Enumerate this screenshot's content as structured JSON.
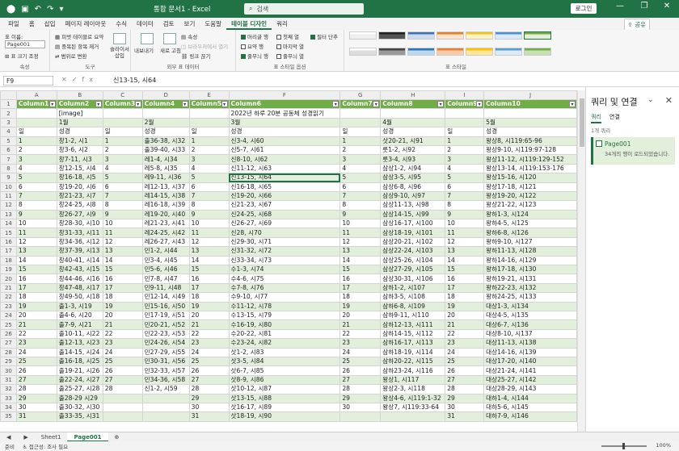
{
  "titlebar": {
    "doc_title": "통합 문서1 - Excel",
    "search_placeholder": "검색",
    "login": "로그인",
    "autosave_icon": "save-icon"
  },
  "tabs": [
    "파일",
    "홈",
    "삽입",
    "페이지 레이아웃",
    "수식",
    "데이터",
    "검토",
    "보기",
    "도움말",
    "테이블 디자인",
    "쿼리"
  ],
  "active_tab": "테이블 디자인",
  "share_label": "공유",
  "ribbon": {
    "props_label": "표 이름:",
    "table_name": "Page001",
    "resize": "표 크기 조정",
    "props_group": "속성",
    "pivot": "피벗 테이블로 요약",
    "remove_dup": "중복된 항목 제거",
    "to_range": "범위로 변환",
    "slicer": "슬라이서 삽입",
    "tools_group": "도구",
    "export": "내보내기",
    "refresh": "새로 고침",
    "properties": "속성",
    "open_browser": "브라우저에서 열기",
    "unlink": "링크 끊기",
    "ext_group": "외부 표 데이터",
    "opt_header": "머리글 행",
    "opt_total": "요약 행",
    "opt_banded": "줄무늬 행",
    "opt_first": "첫째 열",
    "opt_last": "마지막 열",
    "opt_bandcol": "줄무늬 열",
    "opt_filter": "필터 단추",
    "opts_group": "표 스타일 옵션",
    "styles_group": "표 스타일"
  },
  "formula": {
    "name_box": "F9",
    "value": "신13-15, 시64"
  },
  "columns": [
    "A",
    "B",
    "C",
    "D",
    "E",
    "F",
    "G",
    "H",
    "I",
    "J"
  ],
  "table_headers": [
    "Column1",
    "Column2",
    "Column3",
    "Column4",
    "Column5",
    "Column6",
    "Column7",
    "Column8",
    "Column9",
    "Column10"
  ],
  "rows": [
    {
      "n": "2",
      "c": [
        "",
        "[image]",
        "",
        "",
        "",
        "2022년 하루 20분 공동체 성경읽기",
        "",
        "",
        "",
        ""
      ]
    },
    {
      "n": "3",
      "c": [
        "",
        "1월",
        "",
        "2월",
        "",
        "3월",
        "",
        "4월",
        "",
        "5월"
      ]
    },
    {
      "n": "4",
      "c": [
        "일",
        "성경",
        "일",
        "성경",
        "일",
        "성경",
        "일",
        "성경",
        "일",
        "성경"
      ]
    },
    {
      "n": "5",
      "c": [
        "1",
        "창1-2, 시1",
        "1",
        "출36-38, 시32",
        "1",
        "신3-4, 시60",
        "1",
        "삿20-21, 시91",
        "1",
        "왕상8, 시119:65-96"
      ]
    },
    {
      "n": "6",
      "c": [
        "2",
        "창3-6, 시2",
        "2",
        "출39-40, 시33",
        "2",
        "신5-7, 시61",
        "2",
        "룻1-2, 시92",
        "2",
        "왕상9-10, 시119:97-128"
      ]
    },
    {
      "n": "7",
      "c": [
        "3",
        "창7-11, 시3",
        "3",
        "레1-4, 시34",
        "3",
        "신8-10, 시62",
        "3",
        "룻3-4, 시93",
        "3",
        "왕상11-12, 시119:129-152"
      ]
    },
    {
      "n": "8",
      "c": [
        "4",
        "창12-15, 시4",
        "4",
        "레5-8, 시35",
        "4",
        "신11-12, 시63",
        "4",
        "삼상1-2, 시94",
        "4",
        "왕상13-14, 시119:153-176"
      ]
    },
    {
      "n": "9",
      "c": [
        "5",
        "창16-18, 시5",
        "5",
        "레9-11, 시36",
        "5",
        "신13-15, 시64",
        "5",
        "삼상3-5, 시95",
        "5",
        "왕상15-16, 시120"
      ]
    },
    {
      "n": "10",
      "c": [
        "6",
        "창19-20, 시6",
        "6",
        "레12-13, 시37",
        "6",
        "신16-18, 시65",
        "6",
        "삼상6-8, 시96",
        "6",
        "왕상17-18, 시121"
      ]
    },
    {
      "n": "11",
      "c": [
        "7",
        "창21-23, 시7",
        "7",
        "레14-15, 시38",
        "7",
        "신19-20, 시66",
        "7",
        "삼상9-10, 시97",
        "7",
        "왕상19-20, 시122"
      ]
    },
    {
      "n": "12",
      "c": [
        "8",
        "창24-25, 시8",
        "8",
        "레16-18, 시39",
        "8",
        "신21-23, 시67",
        "8",
        "삼상11-13, 시98",
        "8",
        "왕상21-22, 시123"
      ]
    },
    {
      "n": "13",
      "c": [
        "9",
        "창26-27, 시9",
        "9",
        "레19-20, 시40",
        "9",
        "신24-25, 시68",
        "9",
        "삼상14-15, 시99",
        "9",
        "왕하1-3, 시124"
      ]
    },
    {
      "n": "14",
      "c": [
        "10",
        "창28-30, 시10",
        "10",
        "레21-23, 시41",
        "10",
        "신26-27, 시69",
        "10",
        "삼상16-17, 시100",
        "10",
        "왕하4-5, 시125"
      ]
    },
    {
      "n": "15",
      "c": [
        "11",
        "창31-33, 시11",
        "11",
        "레24-25, 시42",
        "11",
        "신28, 시70",
        "11",
        "삼상18-19, 시101",
        "11",
        "왕하6-8, 시126"
      ]
    },
    {
      "n": "16",
      "c": [
        "12",
        "창34-36, 시12",
        "12",
        "레26-27, 시43",
        "12",
        "신29-30, 시71",
        "12",
        "삼상20-21, 시102",
        "12",
        "왕하9-10, 시127"
      ]
    },
    {
      "n": "17",
      "c": [
        "13",
        "창37-39, 시13",
        "13",
        "민1-2, 시44",
        "13",
        "신31-32, 시72",
        "13",
        "삼상22-24, 시103",
        "13",
        "왕하11-13, 시128"
      ]
    },
    {
      "n": "18",
      "c": [
        "14",
        "창40-41, 시14",
        "14",
        "민3-4, 시45",
        "14",
        "신33-34, 시73",
        "14",
        "삼상25-26, 시104",
        "14",
        "왕하14-16, 시129"
      ]
    },
    {
      "n": "19",
      "c": [
        "15",
        "창42-43, 시15",
        "15",
        "민5-6, 시46",
        "15",
        "수1-3, 시74",
        "15",
        "삼상27-29, 시105",
        "15",
        "왕하17-18, 시130"
      ]
    },
    {
      "n": "20",
      "c": [
        "16",
        "창44-46, 시16",
        "16",
        "민7-8, 시47",
        "16",
        "수4-6, 시75",
        "16",
        "삼상30-31, 시106",
        "16",
        "왕하19-21, 시131"
      ]
    },
    {
      "n": "21",
      "c": [
        "17",
        "창47-48, 시17",
        "17",
        "민9-11, 시48",
        "17",
        "수7-8, 시76",
        "17",
        "삼하1-2, 시107",
        "17",
        "왕하22-23, 시132"
      ]
    },
    {
      "n": "22",
      "c": [
        "18",
        "창49-50, 시18",
        "18",
        "민12-14, 시49",
        "18",
        "수9-10, 시77",
        "18",
        "삼하3-5, 시108",
        "18",
        "왕하24-25, 시133"
      ]
    },
    {
      "n": "23",
      "c": [
        "19",
        "출1-3, 시19",
        "19",
        "민15-16, 시50",
        "19",
        "수11-12, 시78",
        "19",
        "삼하6-8, 시109",
        "19",
        "대상1-3, 시134"
      ]
    },
    {
      "n": "24",
      "c": [
        "20",
        "출4-6, 시20",
        "20",
        "민17-19, 시51",
        "20",
        "수13-15, 시79",
        "20",
        "삼하9-11, 시110",
        "20",
        "대상4-5, 시135"
      ]
    },
    {
      "n": "25",
      "c": [
        "21",
        "출7-9, 시21",
        "21",
        "민20-21, 시52",
        "21",
        "수16-19, 시80",
        "21",
        "삼하12-13, 시111",
        "21",
        "대상6-7, 시136"
      ]
    },
    {
      "n": "26",
      "c": [
        "22",
        "출10-11, 시22",
        "22",
        "민22-23, 시53",
        "22",
        "수20-22, 시81",
        "22",
        "삼하14-15, 시112",
        "22",
        "대상8-10, 시137"
      ]
    },
    {
      "n": "27",
      "c": [
        "23",
        "출12-13, 시23",
        "23",
        "민24-26, 시54",
        "23",
        "수23-24, 시82",
        "23",
        "삼하16-17, 시113",
        "23",
        "대상11-13, 시138"
      ]
    },
    {
      "n": "28",
      "c": [
        "24",
        "출14-15, 시24",
        "24",
        "민27-29, 시55",
        "24",
        "삿1-2, 시83",
        "24",
        "삼하18-19, 시114",
        "24",
        "대상14-16, 시139"
      ]
    },
    {
      "n": "29",
      "c": [
        "25",
        "출16-18, 시25",
        "25",
        "민30-31, 시56",
        "25",
        "삿3-5, 시84",
        "25",
        "삼하20-22, 시115",
        "25",
        "대상17-20, 시140"
      ]
    },
    {
      "n": "30",
      "c": [
        "26",
        "출19-21, 시26",
        "26",
        "민32-33, 시57",
        "26",
        "삿6-7, 시85",
        "26",
        "삼하23-24, 시116",
        "26",
        "대상21-24, 시141"
      ]
    },
    {
      "n": "31",
      "c": [
        "27",
        "출22-24, 시27",
        "27",
        "민34-36, 시58",
        "27",
        "삿8-9, 시86",
        "27",
        "왕상1, 시117",
        "27",
        "대상25-27, 시142"
      ]
    },
    {
      "n": "32",
      "c": [
        "28",
        "출25-27, 시28",
        "28",
        "신1-2, 시59",
        "28",
        "삿10-12, 시87",
        "28",
        "왕상2-3, 시118",
        "28",
        "대상28-29, 시143"
      ]
    },
    {
      "n": "33",
      "c": [
        "29",
        "출28-29 시29",
        "",
        "",
        "29",
        "삿13-15, 시88",
        "29",
        "왕상4-6, 시119:1-32",
        "29",
        "대하1-4, 시144"
      ]
    },
    {
      "n": "34",
      "c": [
        "30",
        "출30-32, 시30",
        "",
        "",
        "30",
        "삿16-17, 시89",
        "30",
        "왕상7, 시119:33-64",
        "30",
        "대하5-6, 시145"
      ]
    },
    {
      "n": "35",
      "c": [
        "31",
        "출33-35, 시31",
        "",
        "",
        "31",
        "삿18-19, 시90",
        "",
        "",
        "31",
        "대하7-9, 시146"
      ]
    }
  ],
  "selected_cell": "F9",
  "query_panel": {
    "title": "쿼리 및 연결",
    "tab_queries": "쿼리",
    "tab_connections": "연결",
    "count": "1개 쿼리",
    "item_name": "Page001",
    "item_desc": "34개의 행이 로드되었습니다."
  },
  "sheet_tabs": [
    "Sheet1",
    "Page001"
  ],
  "active_sheet": "Page001",
  "status": {
    "ready": "준비",
    "accessibility": "접근성: 조사 필요",
    "zoom": "100%"
  },
  "colors": {
    "accent": "#217346",
    "table_header": "#70ad47",
    "band": "#e2efda"
  }
}
